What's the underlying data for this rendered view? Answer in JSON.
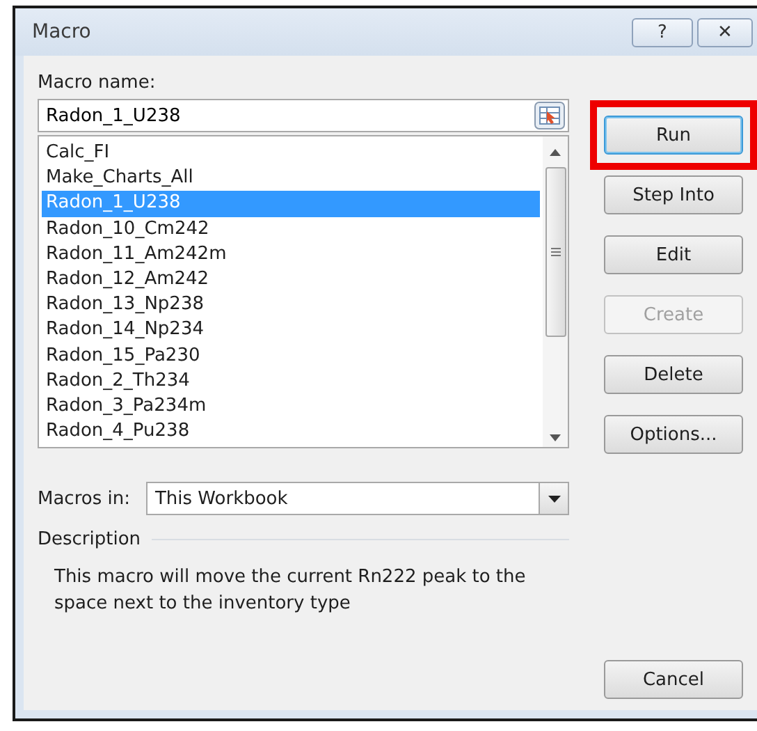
{
  "window": {
    "title": "Macro",
    "controls": [
      "?",
      "✕"
    ]
  },
  "macro_name": {
    "label": "Macro name:",
    "value": "Radon_1_U238"
  },
  "macros": [
    {
      "name": "Calc_FI",
      "selected": false
    },
    {
      "name": "Make_Charts_All",
      "selected": false
    },
    {
      "name": "Radon_1_U238",
      "selected": true
    },
    {
      "name": "Radon_10_Cm242",
      "selected": false
    },
    {
      "name": "Radon_11_Am242m",
      "selected": false
    },
    {
      "name": "Radon_12_Am242",
      "selected": false
    },
    {
      "name": "Radon_13_Np238",
      "selected": false
    },
    {
      "name": "Radon_14_Np234",
      "selected": false
    },
    {
      "name": "Radon_15_Pa230",
      "selected": false
    },
    {
      "name": "Radon_2_Th234",
      "selected": false
    },
    {
      "name": "Radon_3_Pa234m",
      "selected": false
    },
    {
      "name": "Radon_4_Pu238",
      "selected": false
    }
  ],
  "buttons": [
    {
      "label": "Run",
      "disabled": false,
      "highlighted": true,
      "default": true
    },
    {
      "label": "Step Into",
      "disabled": false,
      "highlighted": false,
      "default": false
    },
    {
      "label": "Edit",
      "disabled": false,
      "highlighted": false,
      "default": false
    },
    {
      "label": "Create",
      "disabled": true,
      "highlighted": false,
      "default": false
    },
    {
      "label": "Delete",
      "disabled": false,
      "highlighted": false,
      "default": false
    },
    {
      "label": "Options...",
      "disabled": false,
      "highlighted": false,
      "default": false
    }
  ],
  "macros_in": {
    "label": "Macros in:",
    "value": "This Workbook"
  },
  "description": {
    "label": "Description",
    "text": "This macro will move the current Rn222 peak to the space next to the inventory type"
  },
  "cancel_button": {
    "label": "Cancel"
  }
}
